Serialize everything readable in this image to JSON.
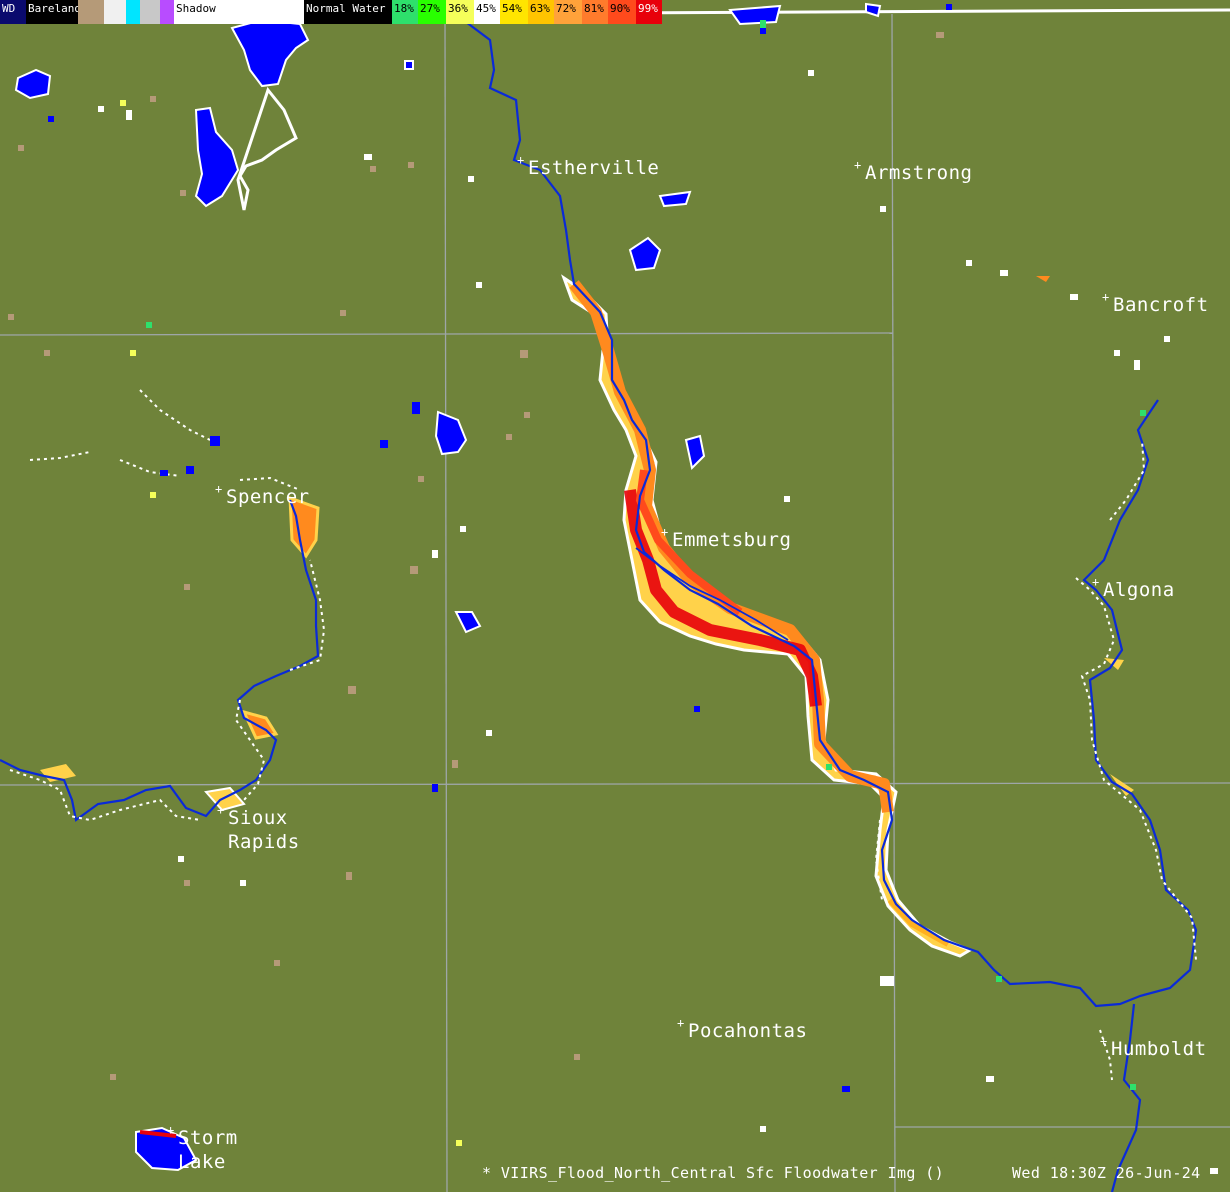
{
  "legend": {
    "items": [
      {
        "label": "WD",
        "color": "#0a0a6e",
        "text_color": "#ffffff"
      },
      {
        "label": "Bareland",
        "color": "#000000",
        "text_color": "#ffffff"
      },
      {
        "label": "",
        "color": "#b59a78"
      },
      {
        "label": "",
        "color": "#f0f0f0"
      },
      {
        "label": "",
        "color": "#00e5ff"
      },
      {
        "label": "",
        "color": "#c8c8c8"
      },
      {
        "label": "",
        "color": "#b84cff"
      },
      {
        "label": "Shadow",
        "color": "#ffffff",
        "text_color": "#000000"
      },
      {
        "label": "",
        "color": "#ffffff"
      },
      {
        "label": "Normal Water",
        "color": "#000000",
        "text_color": "#ffffff"
      },
      {
        "label": "18%",
        "color": "#2ee06c",
        "text_color": "#000000"
      },
      {
        "label": "27%",
        "color": "#29ff00",
        "text_color": "#000000"
      },
      {
        "label": "36%",
        "color": "#f5ff5a",
        "text_color": "#000000"
      },
      {
        "label": "45%",
        "color": "#ffffff",
        "text_color": "#000000"
      },
      {
        "label": "54%",
        "color": "#ffe500",
        "text_color": "#000000"
      },
      {
        "label": "63%",
        "color": "#ffc400",
        "text_color": "#000000"
      },
      {
        "label": "72%",
        "color": "#ffa23a",
        "text_color": "#000000"
      },
      {
        "label": "81%",
        "color": "#ff7b2c",
        "text_color": "#000000"
      },
      {
        "label": "90%",
        "color": "#ff4a1c",
        "text_color": "#000000"
      },
      {
        "label": "99%",
        "color": "#e8000b",
        "text_color": "#ffffff"
      }
    ]
  },
  "cities": [
    {
      "name": "Estherville"
    },
    {
      "name": "Armstrong"
    },
    {
      "name": "Bancroft"
    },
    {
      "name": "Spencer"
    },
    {
      "name": "Emmetsburg"
    },
    {
      "name": "Algona"
    },
    {
      "name": "Sioux\nRapids"
    },
    {
      "name": "Pocahontas"
    },
    {
      "name": "Humboldt"
    },
    {
      "name": "Storm\nLake"
    }
  ],
  "footer": {
    "product": "* VIIRS_Flood_North_Central Sfc Floodwater Img ()",
    "timestamp": "Wed 18:30Z 26-Jun-24"
  },
  "colors": {
    "land": "#6f833a",
    "water": "#0000ff",
    "river_line": "#0a2ad8",
    "county_line": "#9ea6a8",
    "flood_low": "#ffe500",
    "flood_mid": "#ff9b2a",
    "flood_high": "#e8000b"
  }
}
